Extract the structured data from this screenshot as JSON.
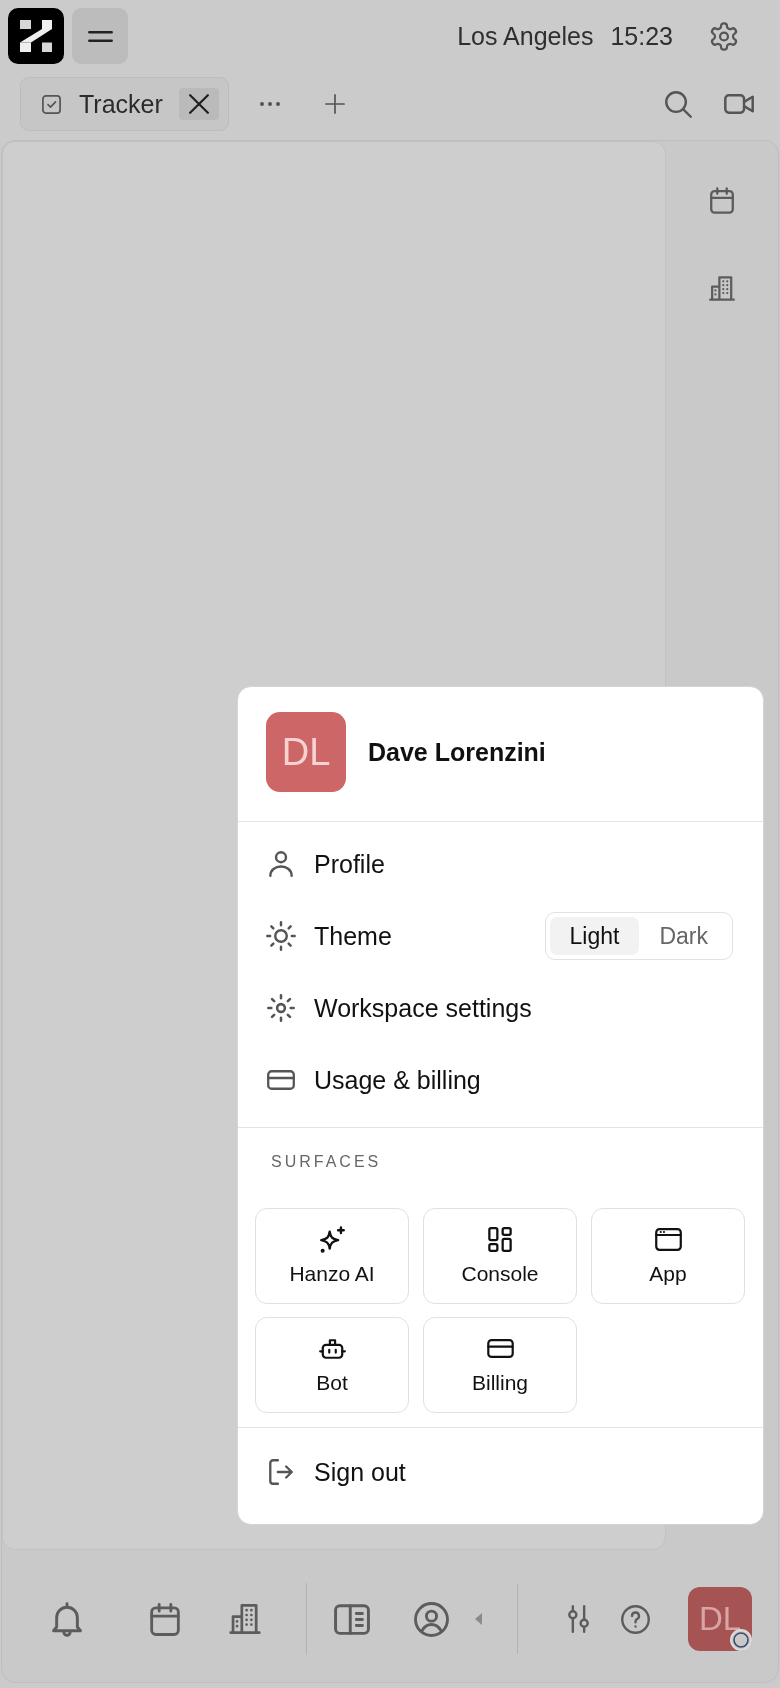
{
  "header": {
    "location": "Los Angeles",
    "time": "15:23"
  },
  "tabs": [
    {
      "label": "Tracker",
      "selected": true
    }
  ],
  "user_menu": {
    "avatar_initials": "DL",
    "name": "Dave Lorenzini",
    "items": [
      {
        "kind": "link",
        "label": "Profile"
      },
      {
        "kind": "toggle",
        "label": "Theme",
        "options": [
          {
            "label": "Light",
            "selected": true
          },
          {
            "label": "Dark",
            "selected": false
          }
        ]
      },
      {
        "kind": "link",
        "label": "Workspace settings"
      },
      {
        "kind": "link",
        "label": "Usage & billing"
      }
    ],
    "surfaces_heading": "SURFACES",
    "surfaces": [
      {
        "label": "Hanzo AI"
      },
      {
        "label": "Console"
      },
      {
        "label": "App"
      },
      {
        "label": "Bot"
      },
      {
        "label": "Billing"
      }
    ],
    "sign_out": "Sign out"
  },
  "bottom_bar": {
    "avatar_initials": "DL"
  }
}
